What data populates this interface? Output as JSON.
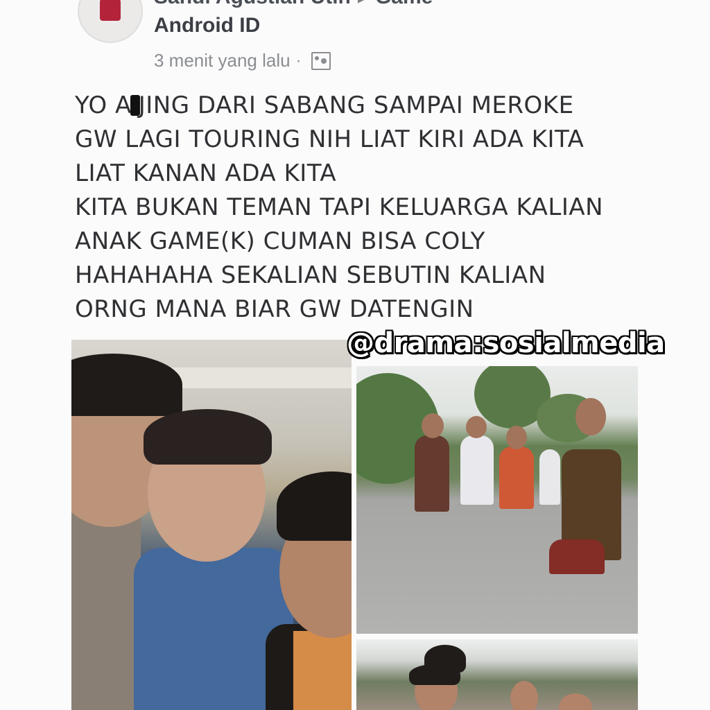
{
  "post": {
    "author_line": "Sandi Agustian Utih",
    "arrow": "▸",
    "group_cut": "Game",
    "group": "Android ID",
    "timestamp": "3 menit yang lalu",
    "separator": "·",
    "audience_icon": "group-audience-icon",
    "text_lines": [
      {
        "before": "YO A",
        "censored": true,
        "after": "JING DARI SABANG SAMPAI MEROKE"
      },
      {
        "before": "GW LAGI TOURING NIH LIAT KIRI ADA KITA",
        "censored": false,
        "after": ""
      },
      {
        "before": "LIAT KANAN ADA KITA",
        "censored": false,
        "after": ""
      },
      {
        "before": "KITA BUKAN TEMAN TAPI KELUARGA KALIAN",
        "censored": false,
        "after": ""
      },
      {
        "before": "ANAK GAME(K) CUMAN BISA COLY",
        "censored": false,
        "after": ""
      },
      {
        "before": "HAHAHAHA SEKALIAN SEBUTIN KALIAN",
        "censored": false,
        "after": ""
      },
      {
        "before": "ORNG MANA BIAR GW DATENGIN",
        "censored": false,
        "after": ""
      }
    ]
  },
  "watermark": "@drama:sosialmedia"
}
